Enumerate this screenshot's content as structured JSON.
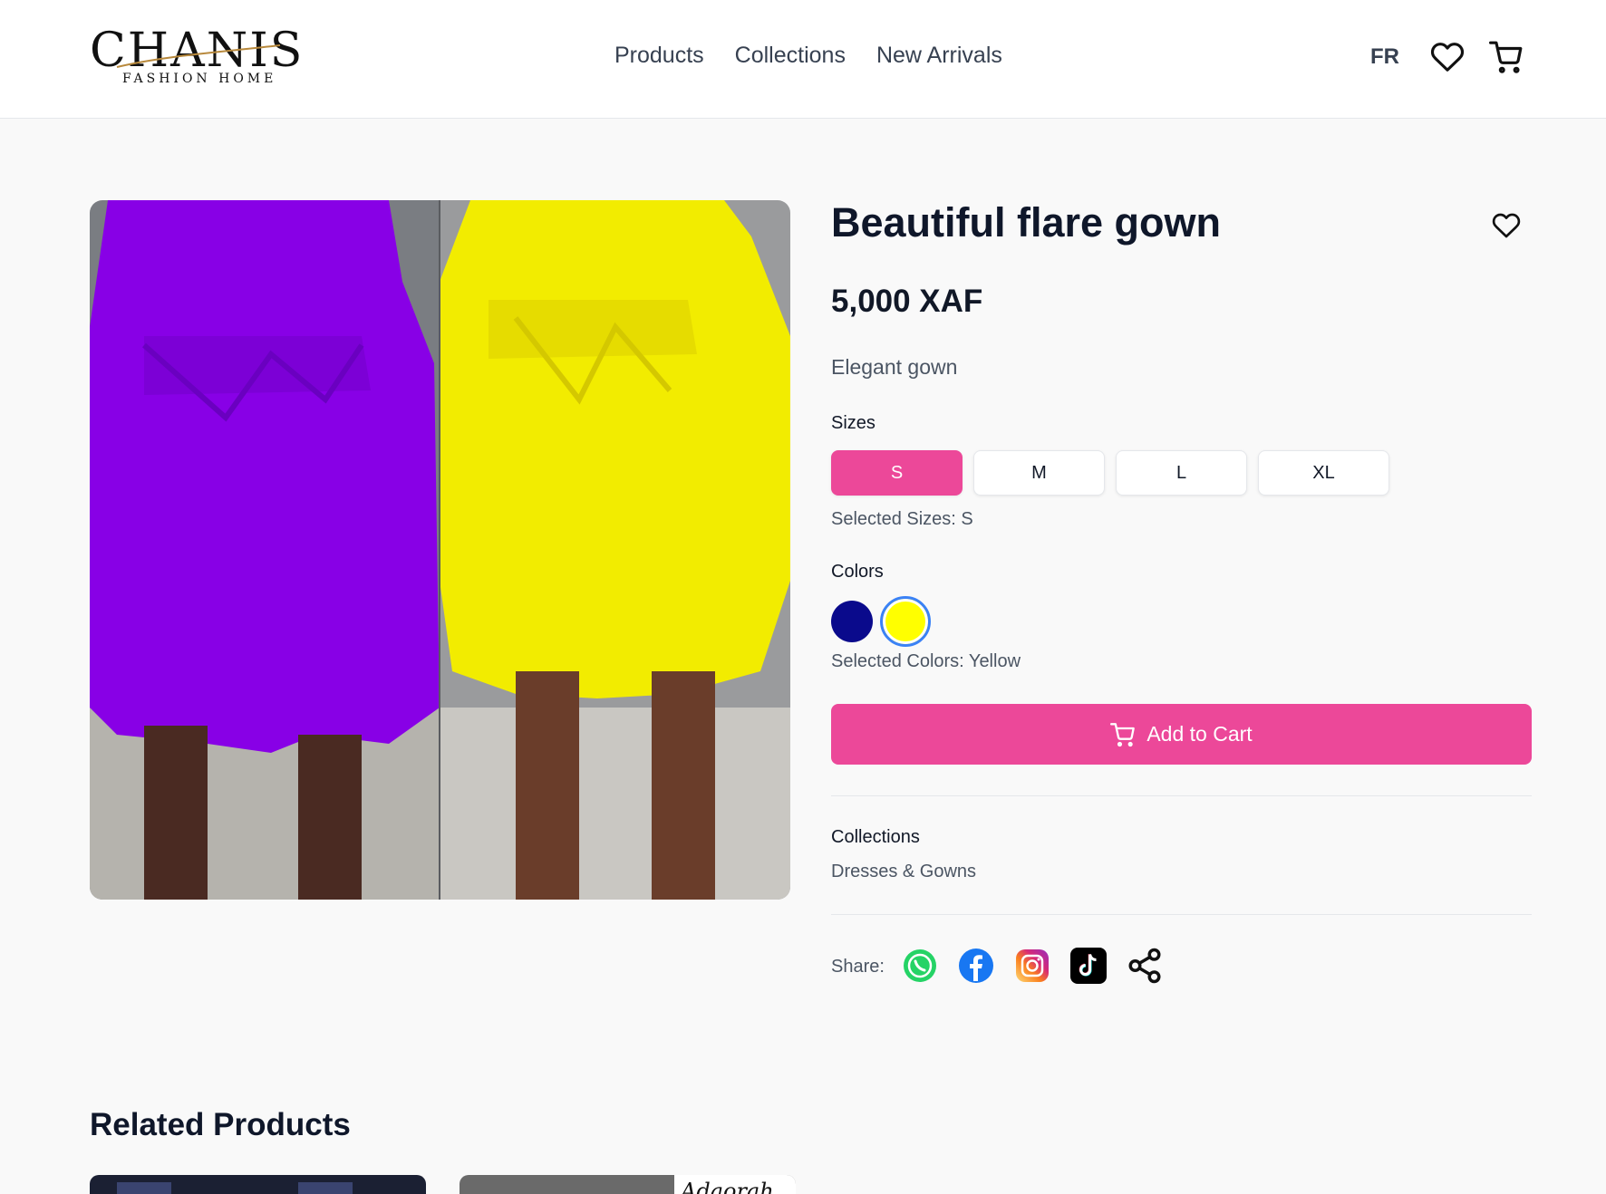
{
  "brand": {
    "name": "CHANIS",
    "tagline": "FASHION HOME"
  },
  "nav": {
    "items": [
      "Products",
      "Collections",
      "New Arrivals"
    ]
  },
  "header": {
    "language": "FR"
  },
  "product": {
    "title": "Beautiful flare gown",
    "price": "5,000 XAF",
    "description": "Elegant gown",
    "sizes_label": "Sizes",
    "sizes": [
      "S",
      "M",
      "L",
      "XL"
    ],
    "selected_size_index": 0,
    "selected_sizes_text": "Selected Sizes: S",
    "colors_label": "Colors",
    "colors": [
      {
        "name": "Navy",
        "hex": "#0a0a8c"
      },
      {
        "name": "Yellow",
        "hex": "#ffff00"
      }
    ],
    "selected_color_index": 1,
    "selected_colors_text": "Selected Colors: Yellow",
    "add_to_cart_label": "Add to Cart",
    "collections_label": "Collections",
    "collections_value": "Dresses & Gowns",
    "share_label": "Share:"
  },
  "share": {
    "icons": [
      "whatsapp-icon",
      "facebook-icon",
      "instagram-icon",
      "tiktok-icon",
      "share-icon"
    ]
  },
  "related": {
    "title": "Related Products",
    "card_2_caption": "Adaorah"
  },
  "colors": {
    "accent": "#ec4899",
    "selected_ring": "#3b82f6"
  }
}
